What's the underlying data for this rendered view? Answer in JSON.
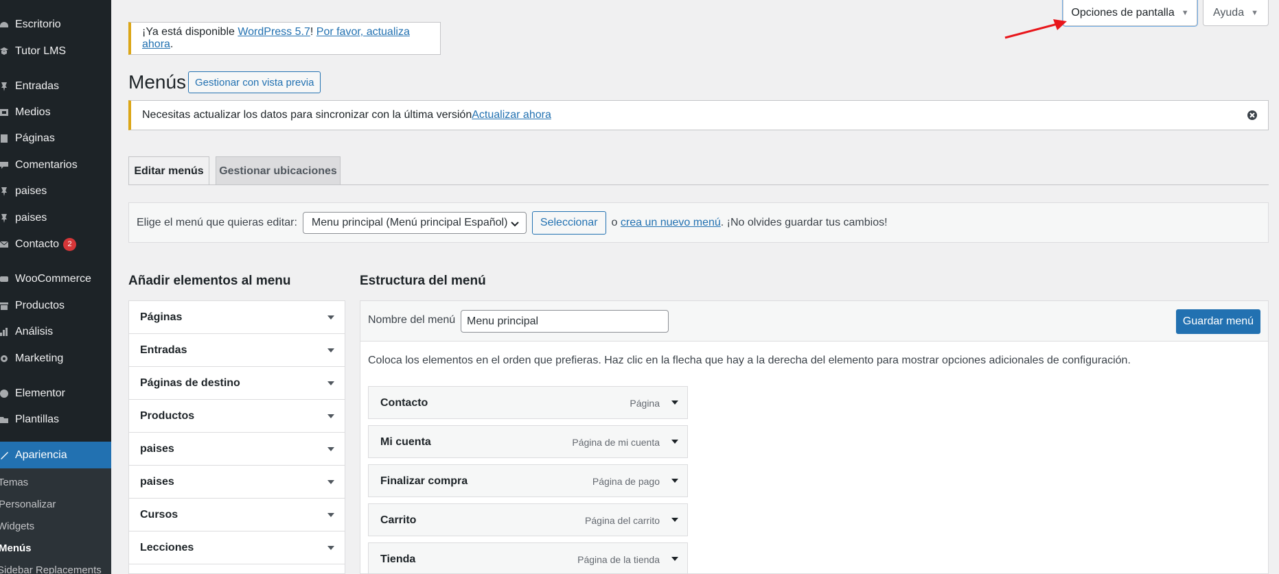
{
  "sidebar": {
    "items": [
      {
        "label": "Escritorio",
        "icon": "dashboard-icon"
      },
      {
        "label": "Tutor LMS",
        "icon": "graduation-icon"
      },
      {
        "label": "Entradas",
        "icon": "pin-icon"
      },
      {
        "label": "Medios",
        "icon": "media-icon"
      },
      {
        "label": "Páginas",
        "icon": "page-icon"
      },
      {
        "label": "Comentarios",
        "icon": "comment-icon"
      },
      {
        "label": "paises",
        "icon": "pin-icon"
      },
      {
        "label": "paises",
        "icon": "pin-icon"
      },
      {
        "label": "Contacto",
        "icon": "mail-icon",
        "badge": "2"
      },
      {
        "label": "WooCommerce",
        "icon": "woo-icon"
      },
      {
        "label": "Productos",
        "icon": "archive-icon"
      },
      {
        "label": "Análisis",
        "icon": "chart-icon"
      },
      {
        "label": "Marketing",
        "icon": "megaphone-icon"
      },
      {
        "label": "Elementor",
        "icon": "elementor-icon"
      },
      {
        "label": "Plantillas",
        "icon": "folder-icon"
      },
      {
        "label": "Apariencia",
        "icon": "brush-icon"
      }
    ],
    "submenu": [
      "Temas",
      "Personalizar",
      "Widgets",
      "Menús",
      "Sidebar Replacements"
    ]
  },
  "top": {
    "screen_options": "Opciones de pantalla",
    "help": "Ayuda"
  },
  "update_nag": {
    "prefix": "¡Ya está disponible ",
    "link1": "WordPress 5.7",
    "middle": "! ",
    "link2": "Por favor, actualiza ahora",
    "suffix": "."
  },
  "page": {
    "title": "Menús",
    "preview_button": "Gestionar con vista previa"
  },
  "sync_notice": {
    "text": "Necesitas actualizar los datos para sincronizar con la última versión",
    "link": "Actualizar ahora"
  },
  "tabs": {
    "edit": "Editar menús",
    "locations": "Gestionar ubicaciones"
  },
  "select_bar": {
    "label": "Elige el menú que quieras editar:",
    "selected": "Menu principal (Menú principal Español)",
    "button": "Seleccionar",
    "or": "o",
    "create_link": "crea un nuevo menú",
    "reminder": ". ¡No olvides guardar tus cambios!"
  },
  "add_items": {
    "title": "Añadir elementos al menu",
    "sections": [
      "Páginas",
      "Entradas",
      "Páginas de destino",
      "Productos",
      "paises",
      "paises",
      "Cursos",
      "Lecciones"
    ]
  },
  "structure": {
    "title": "Estructura del menú",
    "name_label": "Nombre del menú",
    "name_value": "Menu principal",
    "save_button": "Guardar menú",
    "instructions": "Coloca los elementos en el orden que prefieras. Haz clic en la flecha que hay a la derecha del elemento para mostrar opciones adicionales de configuración.",
    "items": [
      {
        "title": "Contacto",
        "type": "Página"
      },
      {
        "title": "Mi cuenta",
        "type": "Página de mi cuenta"
      },
      {
        "title": "Finalizar compra",
        "type": "Página de pago"
      },
      {
        "title": "Carrito",
        "type": "Página del carrito"
      },
      {
        "title": "Tienda",
        "type": "Página de la tienda"
      }
    ]
  },
  "colors": {
    "sidebar_bg": "#1d2327",
    "accent": "#2271b1",
    "notice_border": "#dba617",
    "annotation_arrow": "#e8161b"
  }
}
